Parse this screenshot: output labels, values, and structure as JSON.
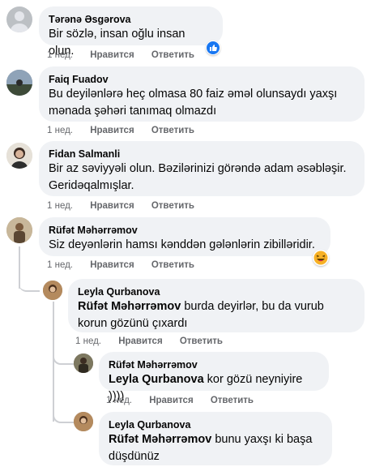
{
  "comments": [
    {
      "author": "Tərənə Əsgərova",
      "text": "Bir sözlə, insan oğlu insan olun.",
      "time": "1 нед.",
      "like": "Нравится",
      "reply": "Ответить",
      "reaction": "like-icon"
    },
    {
      "author": "Faiq Fuadov",
      "line1": "Bu deyilənlərə heç olmasa 80 faiz əməl olunsaydı yaxşı",
      "line2": "mənada şəhəri tanımaq olmazdı",
      "time": "1 нед.",
      "like": "Нравится",
      "reply": "Ответить"
    },
    {
      "author": "Fidan Salmanli",
      "line1": "Bir az səviyyəli olun. Bəzilərinizi görəndə adam əsəbləşir.",
      "line2": "Geridəqalmışlar.",
      "time": "1 нед.",
      "like": "Нравится",
      "reply": "Ответить"
    },
    {
      "author": "Rüfət Məhərrəmov",
      "text": "Siz deyənlərin hamsı kənddən gələnlərin zibilləridir.",
      "time": "1 нед.",
      "like": "Нравится",
      "reply": "Ответить",
      "reaction": "haha-icon"
    }
  ],
  "replies": [
    {
      "author": "Leyla Qurbanova",
      "mention": "Rüfət Məhərrəmov",
      "line1": " burda deyirlər, bu da vurub",
      "line2": "korun gözünü çıxardı",
      "time": "1 нед.",
      "like": "Нравится",
      "reply": "Ответить"
    },
    {
      "author": "Rüfət Məhərrəmov",
      "mention": "Leyla Qurbanova",
      "line1": " kor gözü neyniyire ))))",
      "time": "1 нед.",
      "like": "Нравится",
      "reply": "Ответить"
    },
    {
      "author": "Leyla Qurbanova",
      "mention": "Rüfət Məhərrəmov",
      "line1": " bunu yaxşı ki başa",
      "line2": "düşdünüz"
    }
  ],
  "colors": {
    "bubble": "#f0f2f5",
    "meta": "#65676b",
    "like_blue": "#1877f2",
    "haha_yellow": "#f7b125"
  }
}
